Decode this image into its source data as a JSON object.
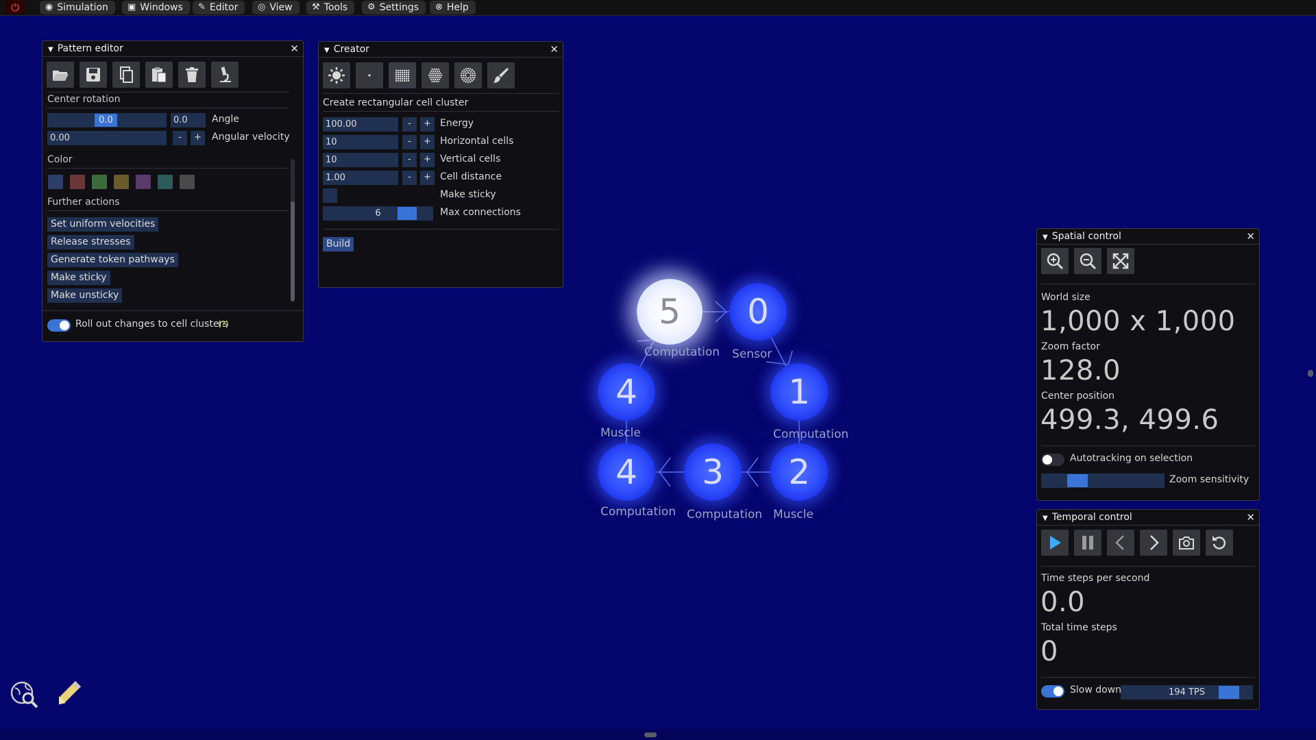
{
  "menubar": {
    "items": [
      {
        "label": "Simulation",
        "icon": "gamepad-icon"
      },
      {
        "label": "Windows",
        "icon": "windows-icon"
      },
      {
        "label": "Editor",
        "icon": "pencil-icon"
      },
      {
        "label": "View",
        "icon": "eye-icon"
      },
      {
        "label": "Tools",
        "icon": "tools-icon"
      },
      {
        "label": "Settings",
        "icon": "gear-icon"
      },
      {
        "label": "Help",
        "icon": "help-icon"
      }
    ]
  },
  "pattern_editor": {
    "title": "Pattern editor",
    "center_rotation_label": "Center rotation",
    "angle_value": "0.0",
    "angle_value2": "0.0",
    "angle_label": "Angle",
    "angular_velocity_value": "0.00",
    "angular_velocity_label": "Angular velocity",
    "minus": "-",
    "plus": "+",
    "color_label": "Color",
    "colors": [
      "#2d3d6a",
      "#6a3636",
      "#3d6a3a",
      "#6a5a2d",
      "#5a3a6a",
      "#2d5a5a",
      "#4a4a4a"
    ],
    "further_actions_label": "Further actions",
    "actions": [
      "Set uniform velocities",
      "Release stresses",
      "Generate token pathways",
      "Make sticky",
      "Make unsticky"
    ],
    "rollout_label": "Roll out changes to cell clusters",
    "rollout_help": "(?)"
  },
  "creator": {
    "title": "Creator",
    "subtitle": "Create rectangular cell cluster",
    "fields": [
      {
        "value": "100.00",
        "label": "Energy"
      },
      {
        "value": "10",
        "label": "Horizontal cells"
      },
      {
        "value": "10",
        "label": "Vertical cells"
      },
      {
        "value": "1.00",
        "label": "Cell distance"
      }
    ],
    "make_sticky_label": "Make sticky",
    "max_connections_value": "6",
    "max_connections_fraction": 0.82,
    "max_connections_label": "Max connections",
    "build_label": "Build"
  },
  "cells": [
    {
      "number": "5",
      "label": "Computation",
      "selected": true
    },
    {
      "number": "0",
      "label": "Sensor",
      "selected": false
    },
    {
      "number": "1",
      "label": "Computation",
      "selected": false
    },
    {
      "number": "2",
      "label": "Muscle",
      "selected": false
    },
    {
      "number": "3",
      "label": "Computation",
      "selected": false
    },
    {
      "number": "4",
      "label": "Computation",
      "selected": false
    },
    {
      "number": "4",
      "label": "Muscle",
      "selected": false
    }
  ],
  "spatial_control": {
    "title": "Spatial control",
    "world_size_label": "World size",
    "world_size_value": "1,000 x 1,000",
    "zoom_factor_label": "Zoom factor",
    "zoom_factor_value": "128.0",
    "center_position_label": "Center position",
    "center_position_value": "499.3, 499.6",
    "autotracking_label": "Autotracking on selection",
    "zoom_sensitivity_label": "Zoom sensitivity",
    "zoom_sensitivity_fraction": 0.25
  },
  "temporal_control": {
    "title": "Temporal control",
    "tps_label": "Time steps per second",
    "tps_value": "0.0",
    "total_label": "Total time steps",
    "total_value": "0",
    "slow_down_label": "Slow down",
    "slow_down_value": "194 TPS",
    "slow_down_fraction": 0.88
  },
  "colors": {
    "background": "#05056e",
    "accent": "#3a74d6",
    "cell": "#3352ff"
  }
}
